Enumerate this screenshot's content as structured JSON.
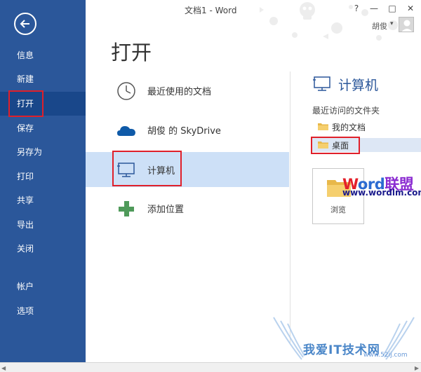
{
  "window": {
    "title": "文档1 - Word",
    "help_label": "?",
    "minimize_label": "—",
    "maximize_label": "□",
    "close_label": "✕",
    "user_name": "胡俊",
    "user_caret": "▾"
  },
  "sidebar": {
    "back_icon": "back-arrow-icon",
    "items": [
      {
        "label": "信息"
      },
      {
        "label": "新建"
      },
      {
        "label": "打开"
      },
      {
        "label": "保存"
      },
      {
        "label": "另存为"
      },
      {
        "label": "打印"
      },
      {
        "label": "共享"
      },
      {
        "label": "导出"
      },
      {
        "label": "关闭"
      },
      {
        "label": "帐户"
      },
      {
        "label": "选项"
      }
    ],
    "active_index": 2
  },
  "main": {
    "title": "打开",
    "locations": [
      {
        "label": "最近使用的文档",
        "icon": "clock-icon"
      },
      {
        "label": "胡俊 的 SkyDrive",
        "icon": "cloud-icon"
      },
      {
        "label": "计算机",
        "icon": "computer-icon"
      },
      {
        "label": "添加位置",
        "icon": "plus-icon"
      }
    ],
    "selected_location": 2
  },
  "right_pane": {
    "title": "计算机",
    "recent_folders_heading": "最近访问的文件夹",
    "folders": [
      {
        "label": "我的文档"
      },
      {
        "label": "桌面"
      }
    ],
    "browse_label": "浏览"
  },
  "watermarks": {
    "word_part1": "W",
    "word_part2": "ord",
    "word_part3": "联盟",
    "url": "www.wordlm.com",
    "bottom_text": "我爱IT技术网",
    "bottom_url": "www.52ij.com"
  },
  "colors": {
    "sidebar": "#2b579a",
    "accent": "#2b579a",
    "selected": "#cde0f7",
    "annotation": "#e0202a"
  }
}
